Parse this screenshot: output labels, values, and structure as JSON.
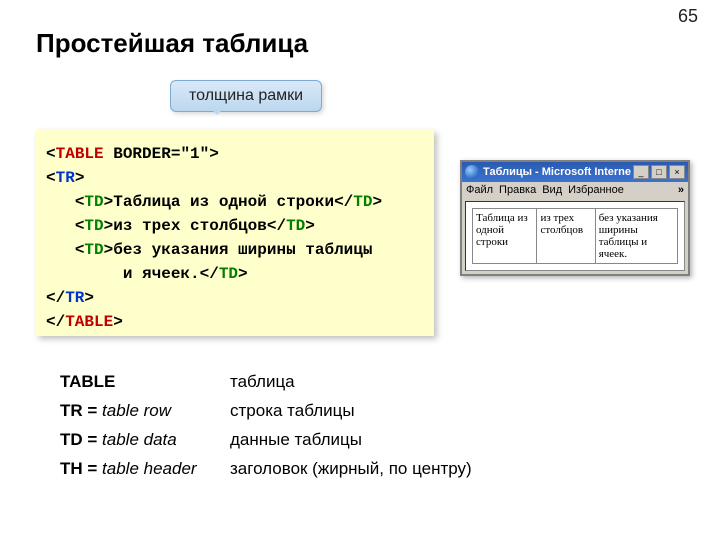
{
  "page_number": "65",
  "title": "Простейшая таблица",
  "callout": "толщина рамки",
  "code": {
    "l1_tag": "TABLE",
    "l1_attr": " BORDER=\"1\"",
    "l2_tag": "TR",
    "l3_tag_o": "TD",
    "l3_txt": "Таблица из одной строки",
    "l3_tag_c": "TD",
    "l4_tag_o": "TD",
    "l4_txt": "из трех столбцов",
    "l4_tag_c": "TD",
    "l5_tag_o": "TD",
    "l5_txt": "без указания ширины таблицы",
    "l6_txt": "и ячеек.",
    "l6_tag_c": "TD",
    "l7_tag": "TR",
    "l8_tag": "TABLE"
  },
  "browser": {
    "title": "Таблицы - Microsoft Internet E...",
    "menu": {
      "file": "Файл",
      "edit": "Правка",
      "view": "Вид",
      "fav": "Избранное",
      "chev": "»"
    },
    "cells": {
      "c1": "Таблица из одной строки",
      "c2": "из трех столбцов",
      "c3": "без указания ширины таблицы и ячеек."
    }
  },
  "defs": {
    "r1_term": "TABLE",
    "r1_desc": "таблица",
    "r2_term": "TR = ",
    "r2_i": "table row",
    "r2_desc": "строка таблицы",
    "r3_term": "TD = ",
    "r3_i": "table data",
    "r3_desc": "данные таблицы",
    "r4_term": "TH = ",
    "r4_i": "table header",
    "r4_desc": "заголовок (жирный, по центру)"
  }
}
